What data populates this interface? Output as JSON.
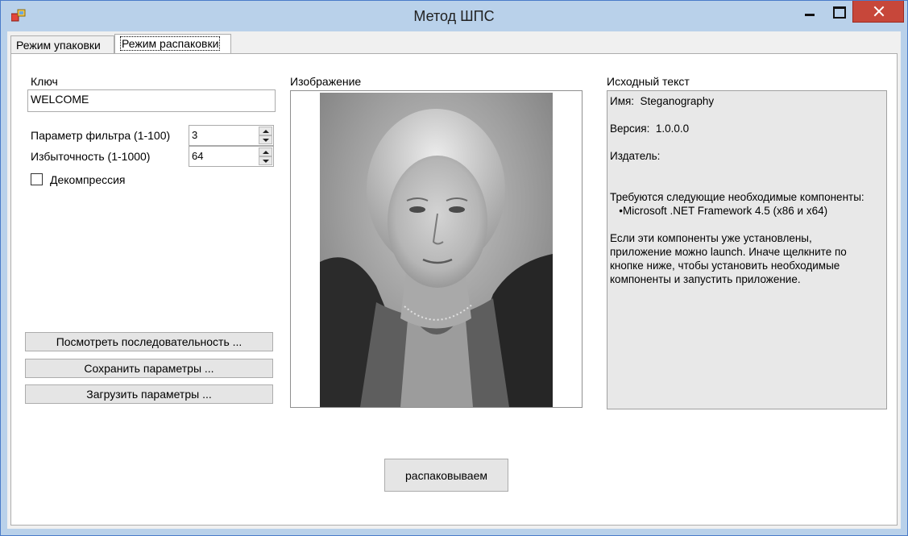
{
  "window": {
    "title": "Метод ШПС"
  },
  "tabs": [
    {
      "label": "Режим упаковки",
      "selected": false
    },
    {
      "label": "Режим распаковки",
      "selected": true
    }
  ],
  "key": {
    "label": "Ключ",
    "value": "WELCOME"
  },
  "filter": {
    "label": "Параметр фильтра (1-100)",
    "value": "3"
  },
  "redundancy": {
    "label": "Избыточность (1-1000)",
    "value": "64"
  },
  "decompression": {
    "label": "Декомпрессия",
    "checked": false
  },
  "buttons": {
    "view_sequence": "Посмотреть последовательность ...",
    "save_params": "Сохранить параметры ...",
    "load_params": "Загрузить параметры ...",
    "unpack": "распаковываем"
  },
  "image": {
    "label": "Изображение",
    "content": "grayscale portrait photo of an elderly woman"
  },
  "source_text": {
    "label": "Исходный текст",
    "lines": [
      "Имя:  Steganography",
      "",
      "Версия:  1.0.0.0",
      "",
      "Издатель:",
      "",
      "",
      "Требуются следующие необходимые компоненты:",
      "   •Microsoft .NET Framework 4.5 (x86 и x64)",
      "",
      "Если эти компоненты уже установлены,",
      "приложение можно launch. Иначе щелкните по",
      "кнопке ниже, чтобы установить необходимые",
      "компоненты и запустить приложение."
    ]
  },
  "colors": {
    "frame": "#b9d1ea",
    "close_button": "#c7473a",
    "tab_background": "#ffffff",
    "panel_gray": "#f0f0f0",
    "textbox_readonly": "#e8e8e8"
  },
  "icons": [
    "app-icon",
    "minimize-icon",
    "maximize-icon",
    "close-icon",
    "spin-up-icon",
    "spin-down-icon"
  ]
}
